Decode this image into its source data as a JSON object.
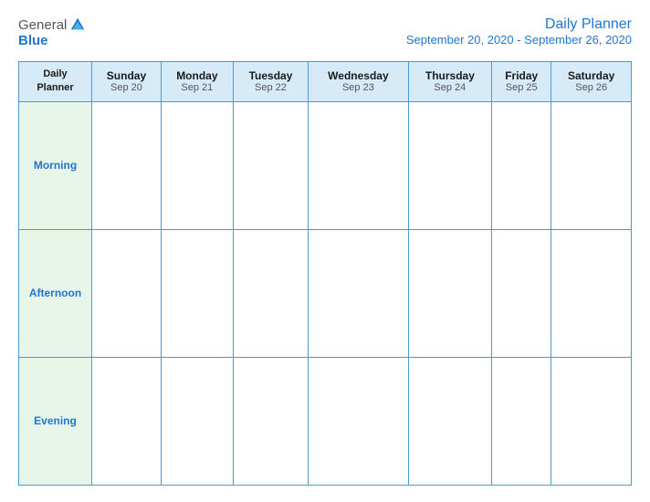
{
  "header": {
    "logo": {
      "general": "General",
      "blue": "Blue"
    },
    "title": "Daily Planner",
    "date_range": "September 20, 2020 - September 26, 2020"
  },
  "table": {
    "planner_label_line1": "Daily",
    "planner_label_line2": "Planner",
    "columns": [
      {
        "day": "Sunday",
        "date": "Sep 20"
      },
      {
        "day": "Monday",
        "date": "Sep 21"
      },
      {
        "day": "Tuesday",
        "date": "Sep 22"
      },
      {
        "day": "Wednesday",
        "date": "Sep 23"
      },
      {
        "day": "Thursday",
        "date": "Sep 24"
      },
      {
        "day": "Friday",
        "date": "Sep 25"
      },
      {
        "day": "Saturday",
        "date": "Sep 26"
      }
    ],
    "rows": [
      {
        "label": "Morning"
      },
      {
        "label": "Afternoon"
      },
      {
        "label": "Evening"
      }
    ]
  }
}
